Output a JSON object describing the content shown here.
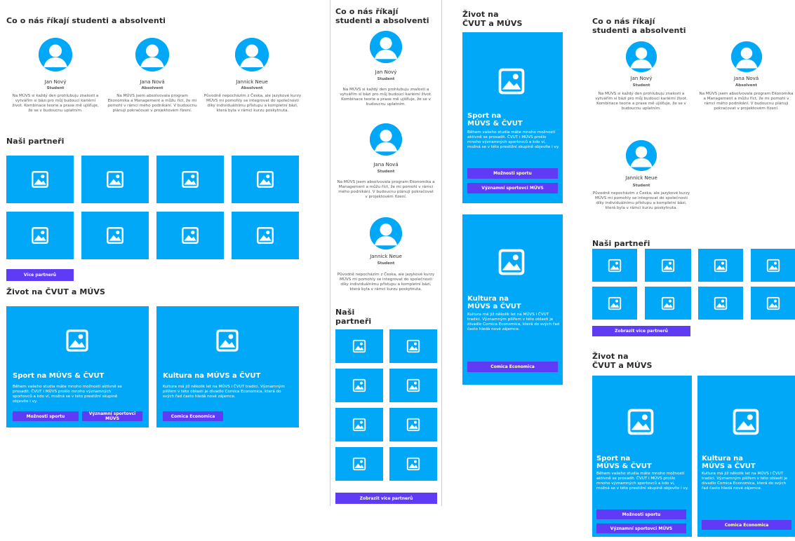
{
  "testimonials": {
    "title": "Co o nás říkají studenti a absolventi",
    "title_line1": "Co o nás říkají",
    "title_line2": "studenti a absolventi",
    "people": [
      {
        "name": "Jan Nový",
        "role": "Student",
        "text": "Na MÚVS si každý den prohlubuju znalosti a vytvářím si bázi pro můj budoucí kariérní život. Kombinace teorie a praxe mě ujišťuje, že se v budoucnu uplatním."
      },
      {
        "name": "Jana Nová",
        "role": "Absolvent",
        "text": "Na MÚVS jsem absolvovala program Ekonomika a Management a můžu říct, že mi pomohl v rámci mého podnikání. V budoucnu plánuji pokračovat v projektovém řízení."
      },
      {
        "name": "Jannick Neue",
        "role": "Absolvent",
        "text": "Původně nepocházím z Česka, ale jazykové kurzy MÚVS mi pomohly se integrovat do společnosti díky individuálnímu přístupu a kompletní bázi, která byla v rámci kurzu poskytnuta."
      }
    ],
    "mobile_roles": [
      "Student",
      "Student",
      "Student"
    ]
  },
  "partners": {
    "title": "Naši partneři",
    "title_line1": "Naši",
    "title_line2": "partneři",
    "more_button": "Více partnerů",
    "show_more_button": "Zobrazit více partnerů",
    "placeholder_icon": "image-placeholder-icon"
  },
  "life": {
    "title": "Život na ČVUT a MÚVS",
    "title_line1": "Život na",
    "title_line2": "ČVUT a MÚVS",
    "sport": {
      "title": "Sport na MÚVS & ČVUT",
      "title_line1": "Sport na",
      "title_line2": "MÚVS & ČVUT",
      "text": "Během vašeho studia máte mnoho možností aktivně se prosadit. ČVUT i MÚVS prošlo mnoho významných sportovců a kdo ví, možná se v této prestižní skupině objevíte i vy.",
      "btn1": "Možnosti sportu",
      "btn2": "Významní sportovci MÚVS"
    },
    "culture": {
      "title": "Kultura na MÚVS a ČVUT",
      "title_line1": "Kultura na",
      "title_line2": "MÚVS a ČVUT",
      "text": "Kultura má již několik let na MÚVS i ČVUT tradici. Významným pilířem v této oblasti je divadlo Comica Economica, která do svých řad často hledá nové zájemce.",
      "btn": "Comica Economica"
    }
  },
  "colors": {
    "accent": "#00a8f7",
    "button": "#5f3bf5",
    "text": "#2a2a2a"
  }
}
